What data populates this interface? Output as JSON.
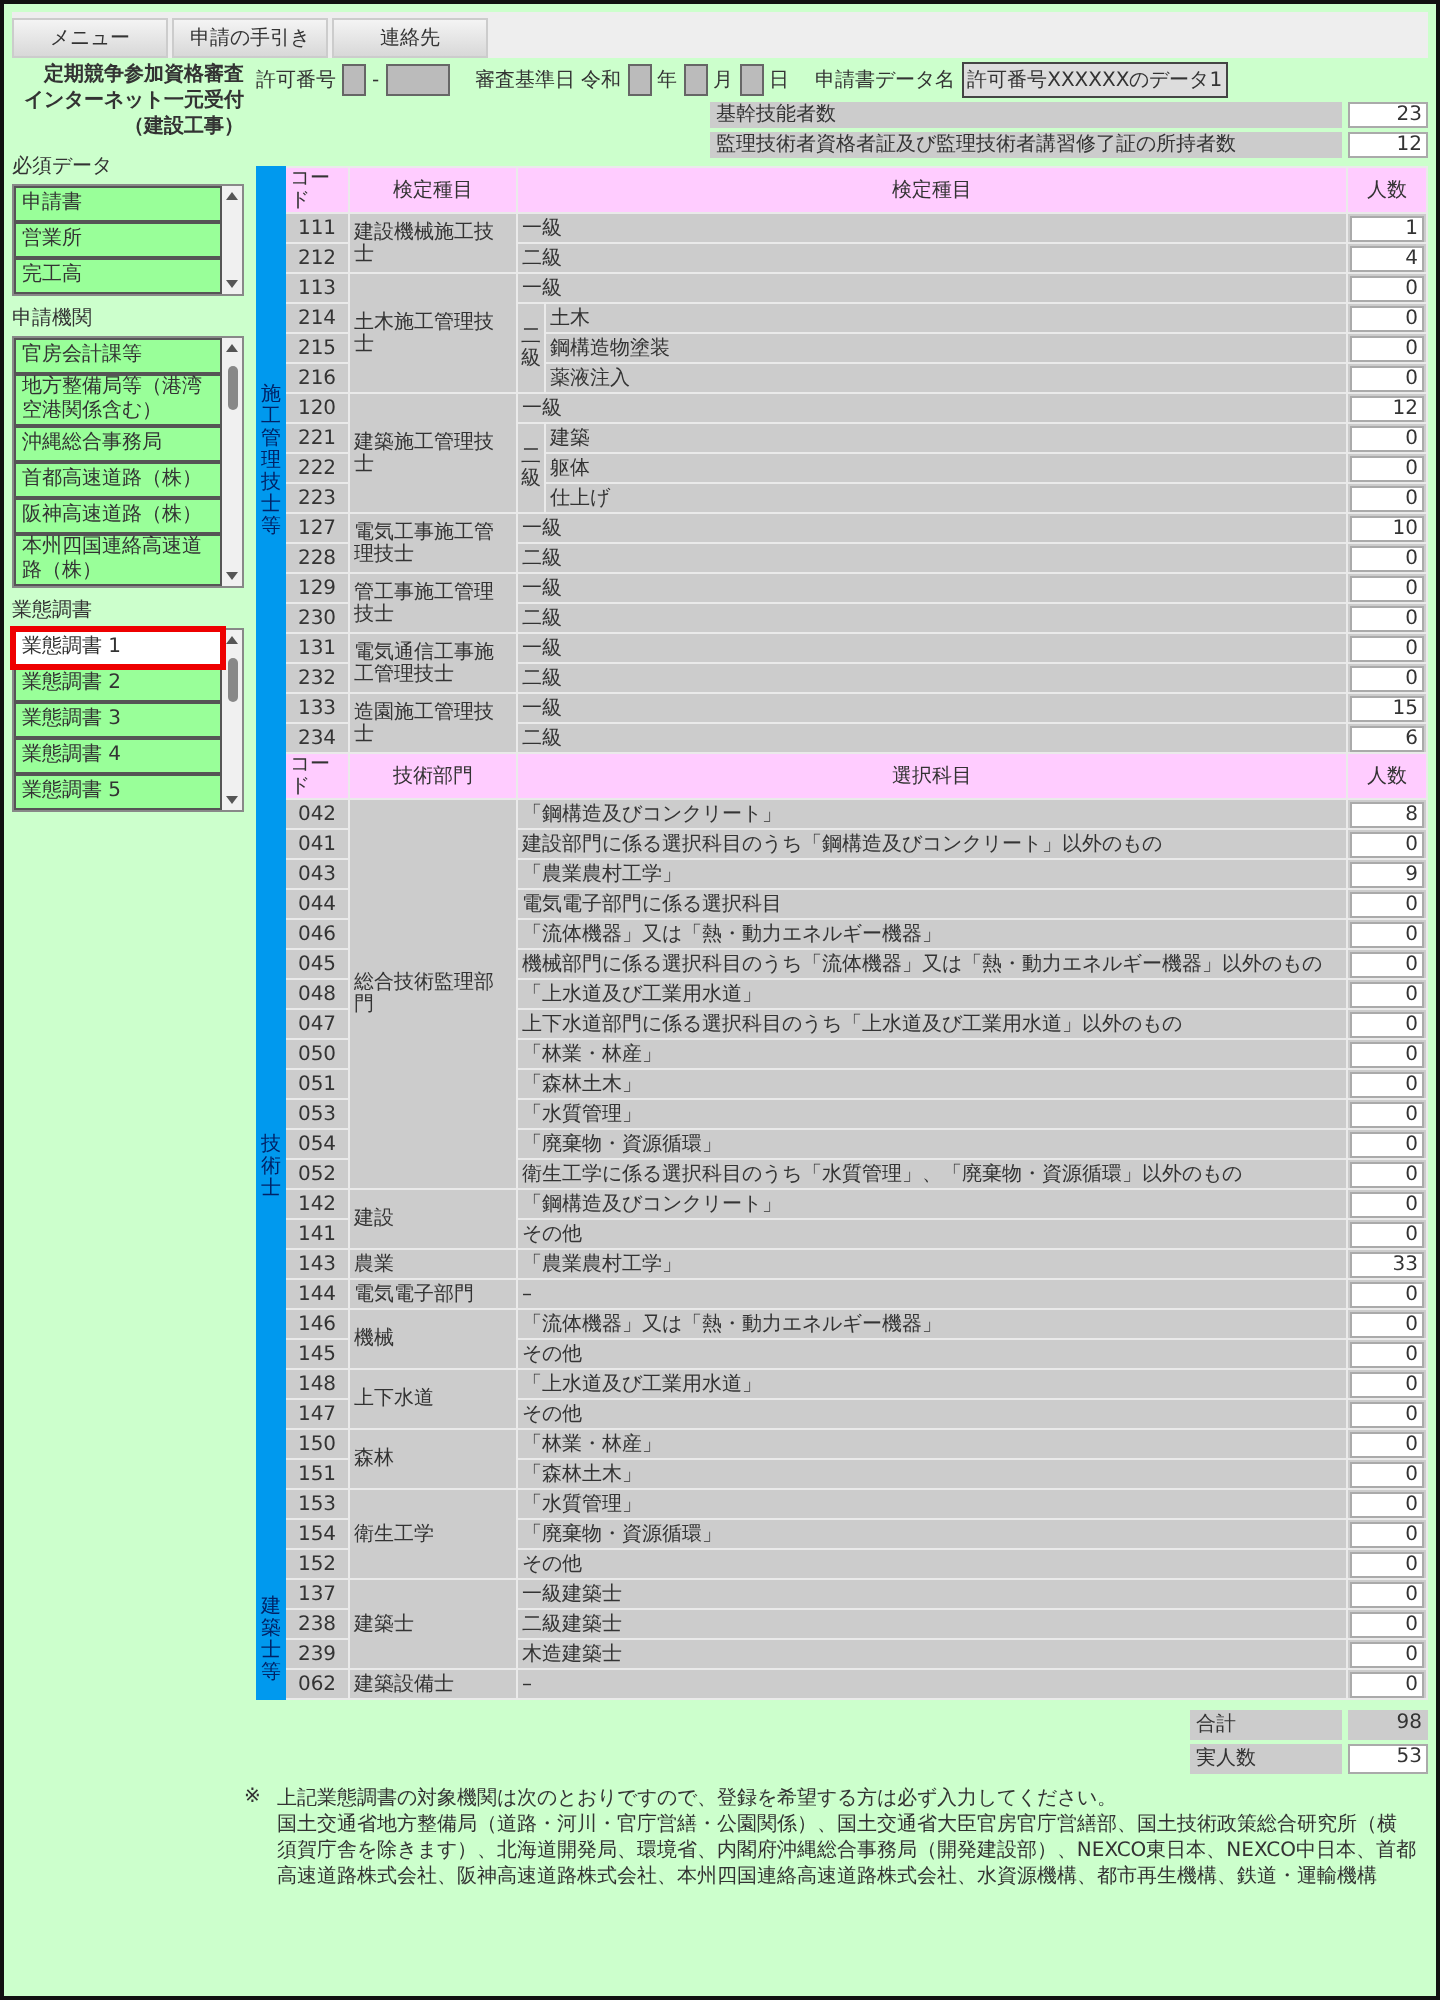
{
  "menu_tabs": [
    "メニュー",
    "申請の手引き",
    "連絡先"
  ],
  "title": [
    "定期競争参加資格審査",
    "インターネット一元受付",
    "（建設工事）"
  ],
  "form": {
    "permit_label": "許可番号",
    "permit_sep": "-",
    "date_label": "審査基準日",
    "era": "令和",
    "year_unit": "年",
    "month_unit": "月",
    "day_unit": "日",
    "data_name_label": "申請書データ名",
    "data_name": "許可番号XXXXXXのデータ1"
  },
  "summary": [
    {
      "label": "基幹技能者数",
      "value": "23"
    },
    {
      "label": "監理技術者資格者証及び監理技術者講習修了証の所持者数",
      "value": "12"
    }
  ],
  "sidebar": [
    {
      "title": "必須データ",
      "items": [
        {
          "label": "申請書",
          "selected": false
        },
        {
          "label": "営業所",
          "selected": false
        },
        {
          "label": "完工高",
          "selected": false
        }
      ]
    },
    {
      "title": "申請機関",
      "items": [
        {
          "label": "官房会計課等",
          "selected": false
        },
        {
          "label": "地方整備局等（港湾空港関係含む）",
          "selected": false
        },
        {
          "label": "沖縄総合事務局",
          "selected": false
        },
        {
          "label": "首都高速道路（株）",
          "selected": false
        },
        {
          "label": "阪神高速道路（株）",
          "selected": false
        },
        {
          "label": "本州四国連絡高速道路（株）",
          "selected": false
        }
      ]
    },
    {
      "title": "業態調書",
      "items": [
        {
          "label": "業態調書 1",
          "selected": true
        },
        {
          "label": "業態調書 2",
          "selected": false
        },
        {
          "label": "業態調書 3",
          "selected": false
        },
        {
          "label": "業態調書 4",
          "selected": false
        },
        {
          "label": "業態調書 5",
          "selected": false
        }
      ]
    }
  ],
  "sections": [
    {
      "label": "施工管理技士等",
      "header": [
        "コード",
        "検定種目",
        "検定種目",
        "人数"
      ],
      "groups": [
        {
          "name": "建設機械施工技士",
          "rows": [
            {
              "kind": "item",
              "code": "111",
              "subject": "一級",
              "count": "1"
            },
            {
              "kind": "item",
              "code": "212",
              "subject": "二級",
              "count": "4"
            }
          ]
        },
        {
          "name": "土木施工管理技士",
          "rows": [
            {
              "kind": "item",
              "code": "113",
              "subject": "一級",
              "count": "0"
            },
            {
              "kind": "sub",
              "label": "二級",
              "rows": [
                {
                  "code": "214",
                  "subject": "土木",
                  "count": "0"
                },
                {
                  "code": "215",
                  "subject": "鋼構造物塗装",
                  "count": "0"
                },
                {
                  "code": "216",
                  "subject": "薬液注入",
                  "count": "0"
                }
              ]
            }
          ]
        },
        {
          "name": "建築施工管理技士",
          "rows": [
            {
              "kind": "item",
              "code": "120",
              "subject": "一級",
              "count": "12"
            },
            {
              "kind": "sub",
              "label": "二級",
              "rows": [
                {
                  "code": "221",
                  "subject": "建築",
                  "count": "0"
                },
                {
                  "code": "222",
                  "subject": "躯体",
                  "count": "0"
                },
                {
                  "code": "223",
                  "subject": "仕上げ",
                  "count": "0"
                }
              ]
            }
          ]
        },
        {
          "name": "電気工事施工管理技士",
          "rows": [
            {
              "kind": "item",
              "code": "127",
              "subject": "一級",
              "count": "10"
            },
            {
              "kind": "item",
              "code": "228",
              "subject": "二級",
              "count": "0"
            }
          ]
        },
        {
          "name": "管工事施工管理技士",
          "rows": [
            {
              "kind": "item",
              "code": "129",
              "subject": "一級",
              "count": "0"
            },
            {
              "kind": "item",
              "code": "230",
              "subject": "二級",
              "count": "0"
            }
          ]
        },
        {
          "name": "電気通信工事施工管理技士",
          "rows": [
            {
              "kind": "item",
              "code": "131",
              "subject": "一級",
              "count": "0"
            },
            {
              "kind": "item",
              "code": "232",
              "subject": "二級",
              "count": "0"
            }
          ]
        },
        {
          "name": "造園施工管理技士",
          "rows": [
            {
              "kind": "item",
              "code": "133",
              "subject": "一級",
              "count": "15"
            },
            {
              "kind": "item",
              "code": "234",
              "subject": "二級",
              "count": "6"
            }
          ]
        }
      ]
    },
    {
      "label": "技術士",
      "header": [
        "コード",
        "技術部門",
        "選択科目",
        "人数"
      ],
      "groups": [
        {
          "name": "総合技術監理部門",
          "rows": [
            {
              "kind": "item",
              "code": "042",
              "subject": "「鋼構造及びコンクリート」",
              "count": "8"
            },
            {
              "kind": "item",
              "code": "041",
              "subject": "建設部門に係る選択科目のうち「鋼構造及びコンクリート」以外のもの",
              "count": "0"
            },
            {
              "kind": "item",
              "code": "043",
              "subject": "「農業農村工学」",
              "count": "9"
            },
            {
              "kind": "item",
              "code": "044",
              "subject": "電気電子部門に係る選択科目",
              "count": "0"
            },
            {
              "kind": "item",
              "code": "046",
              "subject": "「流体機器」又は「熱・動力エネルギー機器」",
              "count": "0"
            },
            {
              "kind": "item",
              "code": "045",
              "subject": "機械部門に係る選択科目のうち「流体機器」又は「熱・動力エネルギー機器」以外のもの",
              "count": "0"
            },
            {
              "kind": "item",
              "code": "048",
              "subject": "「上水道及び工業用水道」",
              "count": "0"
            },
            {
              "kind": "item",
              "code": "047",
              "subject": "上下水道部門に係る選択科目のうち「上水道及び工業用水道」以外のもの",
              "count": "0"
            },
            {
              "kind": "item",
              "code": "050",
              "subject": "「林業・林産」",
              "count": "0"
            },
            {
              "kind": "item",
              "code": "051",
              "subject": "「森林土木」",
              "count": "0"
            },
            {
              "kind": "item",
              "code": "053",
              "subject": "「水質管理」",
              "count": "0"
            },
            {
              "kind": "item",
              "code": "054",
              "subject": "「廃棄物・資源循環」",
              "count": "0"
            },
            {
              "kind": "item",
              "code": "052",
              "subject": "衛生工学に係る選択科目のうち「水質管理」、「廃棄物・資源循環」以外のもの",
              "count": "0"
            }
          ]
        },
        {
          "name": "建設",
          "rows": [
            {
              "kind": "item",
              "code": "142",
              "subject": "「鋼構造及びコンクリート」",
              "count": "0"
            },
            {
              "kind": "item",
              "code": "141",
              "subject": "その他",
              "count": "0"
            }
          ]
        },
        {
          "name": "農業",
          "rows": [
            {
              "kind": "item",
              "code": "143",
              "subject": "「農業農村工学」",
              "count": "33"
            }
          ]
        },
        {
          "name": "電気電子部門",
          "rows": [
            {
              "kind": "item",
              "code": "144",
              "subject": "–",
              "count": "0"
            }
          ]
        },
        {
          "name": "機械",
          "rows": [
            {
              "kind": "item",
              "code": "146",
              "subject": "「流体機器」又は「熱・動力エネルギー機器」",
              "count": "0"
            },
            {
              "kind": "item",
              "code": "145",
              "subject": "その他",
              "count": "0"
            }
          ]
        },
        {
          "name": "上下水道",
          "rows": [
            {
              "kind": "item",
              "code": "148",
              "subject": "「上水道及び工業用水道」",
              "count": "0"
            },
            {
              "kind": "item",
              "code": "147",
              "subject": "その他",
              "count": "0"
            }
          ]
        },
        {
          "name": "森林",
          "rows": [
            {
              "kind": "item",
              "code": "150",
              "subject": "「林業・林産」",
              "count": "0"
            },
            {
              "kind": "item",
              "code": "151",
              "subject": "「森林土木」",
              "count": "0"
            }
          ]
        },
        {
          "name": "衛生工学",
          "rows": [
            {
              "kind": "item",
              "code": "153",
              "subject": "「水質管理」",
              "count": "0"
            },
            {
              "kind": "item",
              "code": "154",
              "subject": "「廃棄物・資源循環」",
              "count": "0"
            },
            {
              "kind": "item",
              "code": "152",
              "subject": "その他",
              "count": "0"
            }
          ]
        }
      ]
    },
    {
      "label": "建築士等",
      "groups": [
        {
          "name": "建築士",
          "rows": [
            {
              "kind": "item",
              "code": "137",
              "subject": "一級建築士",
              "count": "0"
            },
            {
              "kind": "item",
              "code": "238",
              "subject": "二級建築士",
              "count": "0"
            },
            {
              "kind": "item",
              "code": "239",
              "subject": "木造建築士",
              "count": "0"
            }
          ]
        },
        {
          "name": "建築設備士",
          "rows": [
            {
              "kind": "item",
              "code": "062",
              "subject": "–",
              "count": "0"
            }
          ]
        }
      ]
    }
  ],
  "totals": [
    {
      "label": "合計",
      "value": "98",
      "kind": "readonly"
    },
    {
      "label": "実人数",
      "value": "53",
      "kind": "input"
    }
  ],
  "notes": {
    "mark": "※",
    "paragraphs": [
      "上記業態調書の対象機関は次のとおりですので、登録を希望する方は必ず入力してください。",
      "国土交通省地方整備局（道路・河川・官庁営繕・公園関係）、国土交通省大臣官房官庁営繕部、国土技術政策総合研究所（横須賀庁舎を除きます）、北海道開発局、環境省、内閣府沖縄総合事務局（開発建設部）、NEXCO東日本、NEXCO中日本、首都高速道路株式会社、阪神高速道路株式会社、本州四国連絡高速道路株式会社、水資源機構、都市再生機構、鉄道・運輸機構"
    ]
  }
}
